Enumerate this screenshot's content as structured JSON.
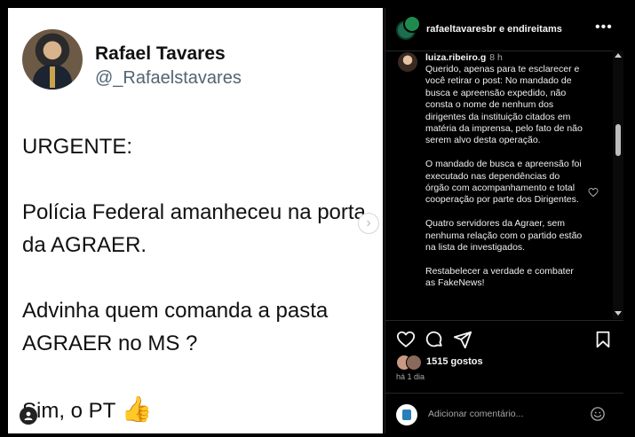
{
  "post": {
    "author_name": "Rafael Tavares",
    "author_handle": "@_Rafaelstavares",
    "text": "URGENTE:\n\nPolícia Federal amanheceu na porta da AGRAER.\n\nAdvinha quem comanda a pasta AGRAER no MS ?\n\nSim, o PT",
    "thumb_emoji": "👍",
    "next_arrow_icon": "chevron-right-icon"
  },
  "header": {
    "names": "rafaeltavaresbr e endireitams",
    "more_icon": "more-dots-icon"
  },
  "comment": {
    "user": "luiza.ribeiro.g",
    "time": "8 h",
    "text": "Querido, apenas para te esclarecer e você retirar o post: No mandado de busca e apreensão expedido, não consta o nome de nenhum dos dirigentes da instituição citados em matéria da imprensa, pelo fato de não serem alvo desta operação.\n\nO mandado de busca e apreensão foi executado nas dependências do órgão com acompanhamento e total cooperação por parte dos Dirigentes.\n\nQuatro servidores da Agraer, sem nenhuma relação com o partido estão na lista de investigados.\n\nRestabelecer a verdade e combater as FakeNews!"
  },
  "engagement": {
    "likes": "1515 gostos",
    "date": "há 1 dia"
  },
  "add_comment": {
    "placeholder": "Adicionar comentário..."
  },
  "colors": {
    "background": "#000000",
    "post_bg": "#ffffff",
    "muted_text": "#a8a8a8",
    "handle_gray": "#536471"
  }
}
